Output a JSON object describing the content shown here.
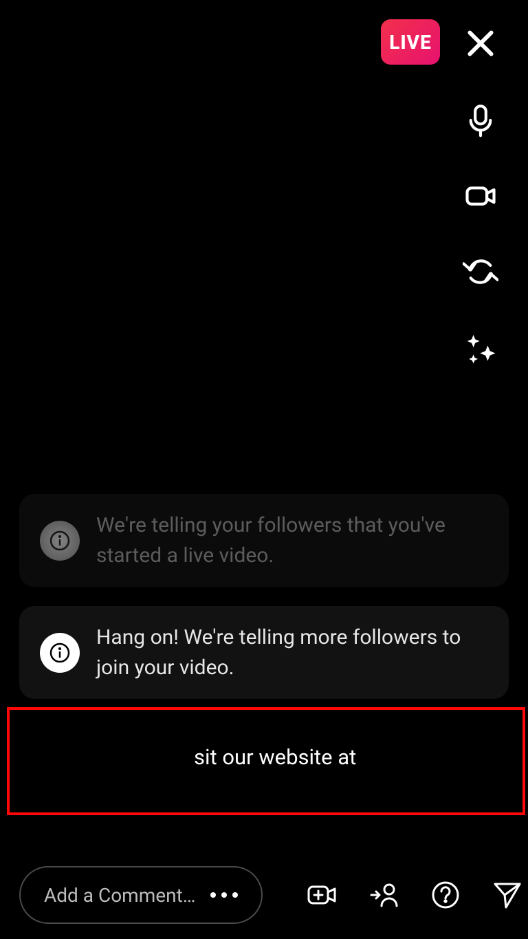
{
  "header": {
    "live_label": "LIVE"
  },
  "notices": [
    {
      "text": "We're telling your followers that you've started a live video."
    },
    {
      "text": "Hang on! We're telling more followers to join your video."
    }
  ],
  "highlighted_message": {
    "visible_text": "sit our website at"
  },
  "bottom": {
    "comment_placeholder": "Add a Comment…"
  },
  "icons": {
    "close": "close-icon",
    "mic": "microphone-icon",
    "camera": "camera-icon",
    "flip": "flip-camera-icon",
    "sparkle": "sparkle-icon",
    "info": "info-icon",
    "more": "more-options-icon",
    "add_video": "add-video-icon",
    "invite": "invite-person-icon",
    "help": "help-icon",
    "send": "send-icon"
  }
}
